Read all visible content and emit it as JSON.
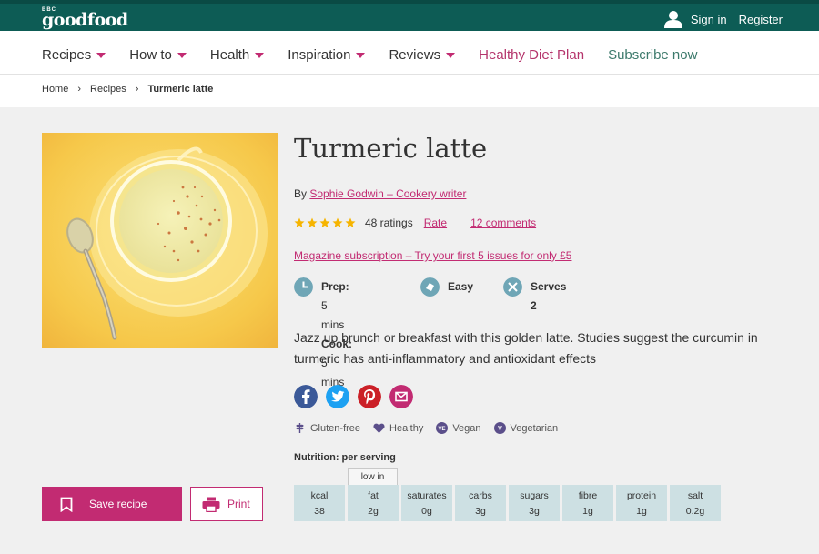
{
  "header": {
    "logo_small": "BBC",
    "logo_text": "goodfood",
    "sign_in": "Sign in",
    "register": "Register"
  },
  "nav": {
    "items": [
      {
        "label": "Recipes",
        "has_caret": true
      },
      {
        "label": "How to",
        "has_caret": true
      },
      {
        "label": "Health",
        "has_caret": true
      },
      {
        "label": "Inspiration",
        "has_caret": true
      },
      {
        "label": "Reviews",
        "has_caret": true
      },
      {
        "label": "Healthy Diet Plan",
        "has_caret": false
      },
      {
        "label": "Subscribe now",
        "has_caret": false
      }
    ]
  },
  "breadcrumb": {
    "home": "Home",
    "recipes": "Recipes",
    "current": "Turmeric latte"
  },
  "recipe": {
    "title": "Turmeric latte",
    "by_prefix": "By",
    "author": "Sophie Godwin – Cookery writer",
    "stars": 5,
    "ratings": "48 ratings",
    "rate_link": "Rate",
    "comments_link": "12 comments",
    "magazine_link": "Magazine subscription – Try your first 5 issues for only £5",
    "prep_label": "Prep:",
    "prep_value": "5 mins",
    "cook_label": "Cook:",
    "cook_value": "5 mins",
    "difficulty": "Easy",
    "serves": "Serves 2",
    "description": "Jazz up brunch or breakfast with this golden latte. Studies suggest the curcumin in turmeric has anti-inflammatory and antioxidant effects"
  },
  "tags": [
    "Gluten-free",
    "Healthy",
    "Vegan",
    "Vegetarian"
  ],
  "tag_badges": {
    "vegan": "VE",
    "vegetarian": "V"
  },
  "nutrition": {
    "label": "Nutrition: per serving",
    "low_in": "low in",
    "items": [
      {
        "name": "kcal",
        "value": "38"
      },
      {
        "name": "fat",
        "value": "2g"
      },
      {
        "name": "saturates",
        "value": "0g"
      },
      {
        "name": "carbs",
        "value": "3g"
      },
      {
        "name": "sugars",
        "value": "3g"
      },
      {
        "name": "fibre",
        "value": "1g"
      },
      {
        "name": "protein",
        "value": "1g"
      },
      {
        "name": "salt",
        "value": "0.2g"
      }
    ]
  },
  "actions": {
    "save": "Save recipe",
    "print": "Print"
  },
  "social": [
    "facebook-icon",
    "twitter-icon",
    "pinterest-icon",
    "email-icon"
  ],
  "colors": {
    "header_green": "#0d5c55",
    "accent_pink": "#c22b72",
    "star": "#f6b400",
    "nutrition_cell": "#cde0e3"
  }
}
